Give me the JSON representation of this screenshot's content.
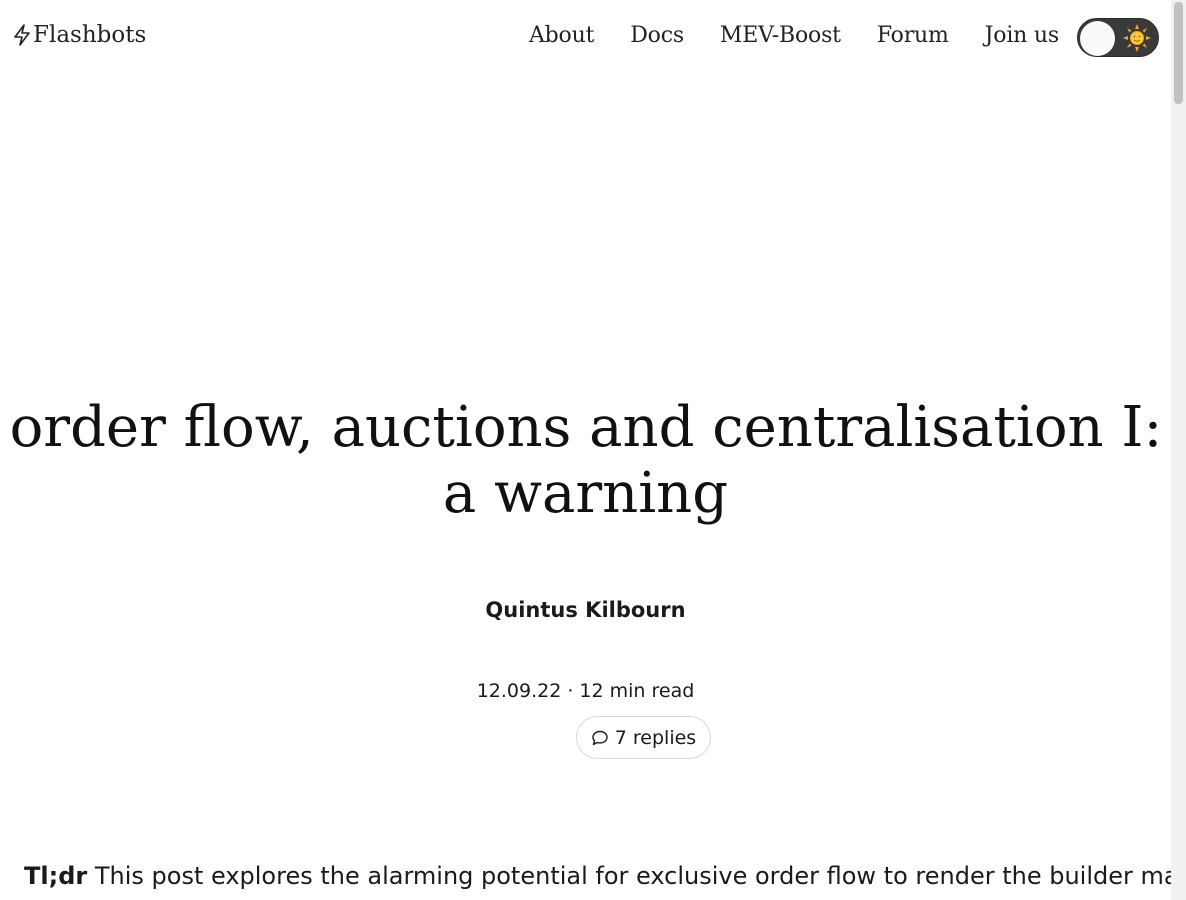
{
  "header": {
    "logo_text": "Flashbots",
    "logo_icon": "lightning-bolt-icon",
    "nav": [
      {
        "label": "About"
      },
      {
        "label": "Docs"
      },
      {
        "label": "MEV-Boost"
      },
      {
        "label": "Forum"
      },
      {
        "label": "Join us"
      }
    ],
    "theme_toggle": {
      "icon": "sun-icon",
      "state": "light"
    }
  },
  "article": {
    "title_line1": "order flow, auctions and centralisation I:",
    "title_line2": "a warning",
    "author": "Quintus Kilbourn",
    "meta": "12.09.22 · 12 min read",
    "replies_label": "7 replies",
    "replies_icon": "speech-bubble-icon",
    "tldr_label": "Tl;dr",
    "tldr_text": " This post explores the alarming potential for exclusive order flow to render the builder market"
  },
  "colors": {
    "text": "#111111",
    "toggle_bg": "#3a3a3a",
    "pill_border": "#d8d8d8",
    "background": "#ffffff"
  }
}
